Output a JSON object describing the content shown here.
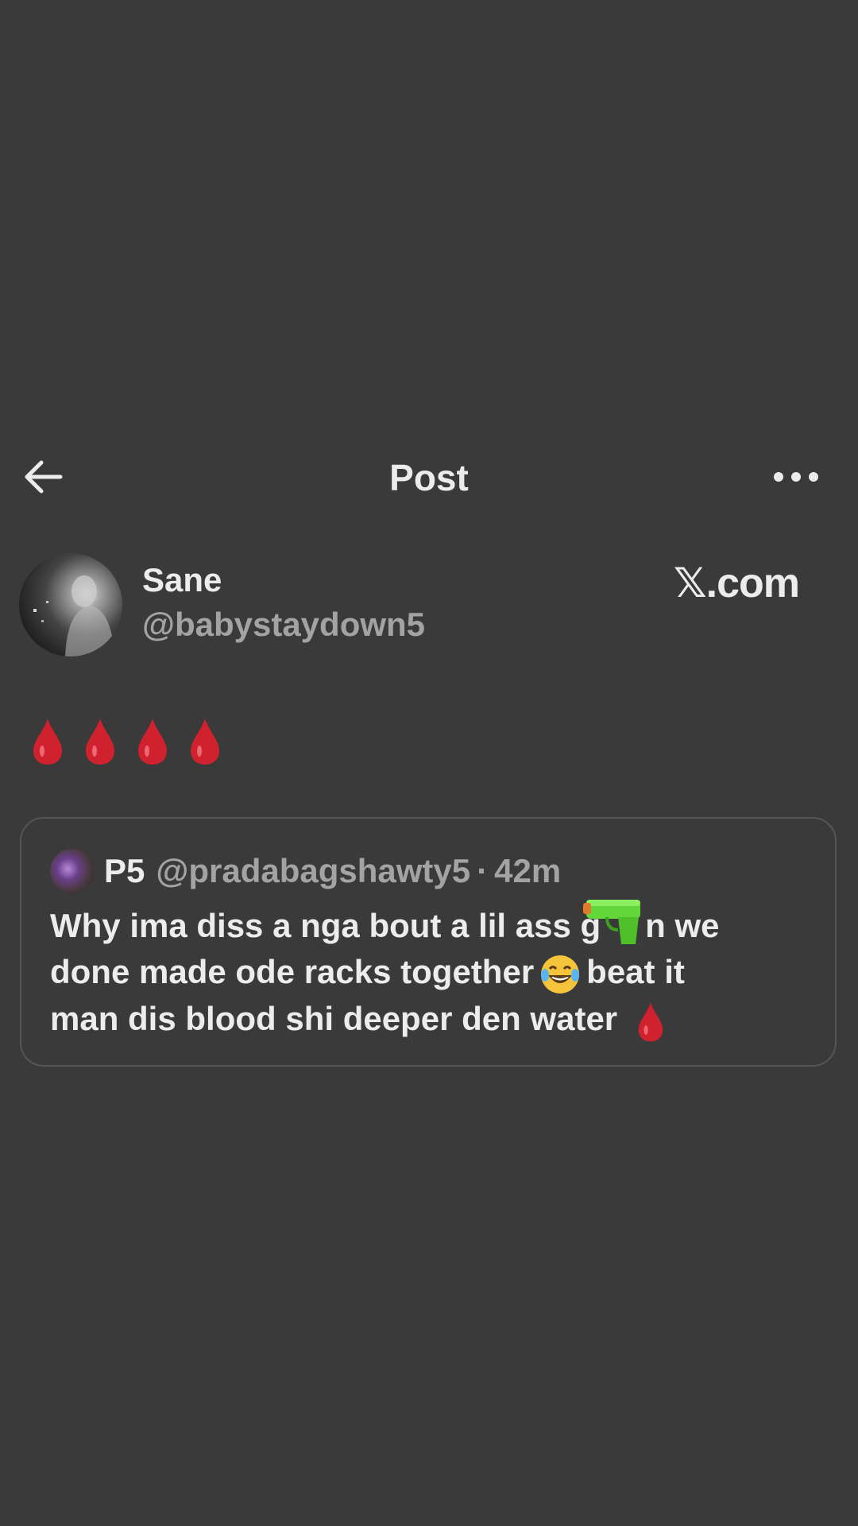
{
  "header": {
    "title": "Post",
    "back_icon": "arrow-left-icon",
    "more_icon": "more-horizontal-icon"
  },
  "author": {
    "display_name": "Sane",
    "handle": "@babystaydown5",
    "watermark": "𝕏.com"
  },
  "post": {
    "emoji": [
      "blood-drop",
      "blood-drop",
      "blood-drop",
      "blood-drop"
    ]
  },
  "quoted_post": {
    "name": "P5",
    "handle": "@pradabagshawty5",
    "separator": "·",
    "time": "42m",
    "line1_before": "Why ima diss a nga bout a lil ass g",
    "line1_after": "n we",
    "line2_before": "done made ode racks together",
    "line2_after": "beat it",
    "line3": "man dis blood shi deeper den water"
  },
  "colors": {
    "background": "#3a3a3a",
    "text_primary": "#ececec",
    "text_secondary": "#a3a3a3",
    "border": "#555555",
    "blood": "#d0212f",
    "water_gun": "#63d63a"
  }
}
